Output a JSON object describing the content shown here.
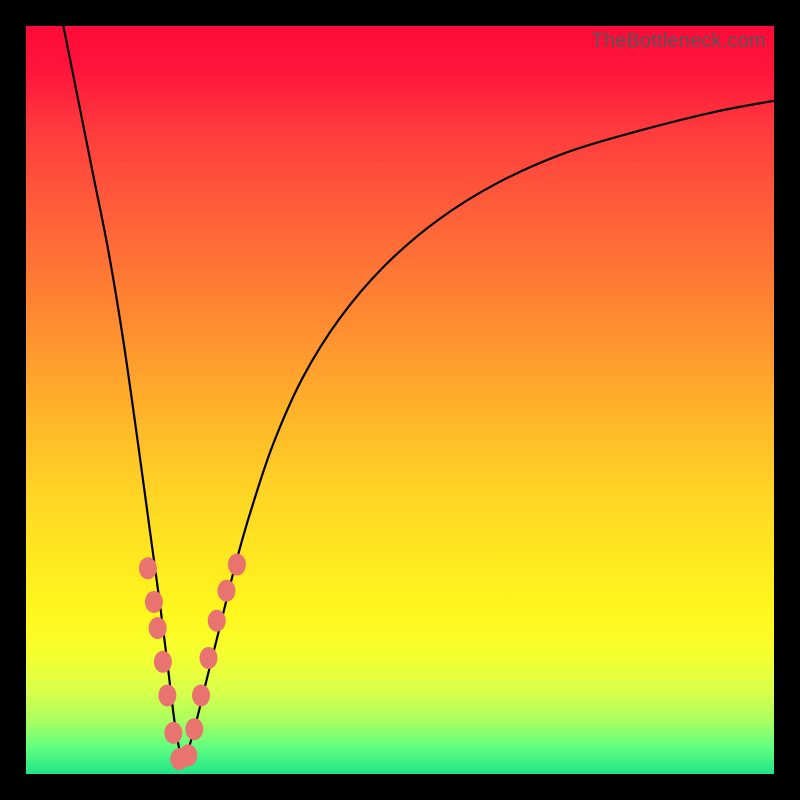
{
  "watermark": "TheBottleneck.com",
  "colors": {
    "background": "#000000",
    "gradient_top": "#ff0a3a",
    "gradient_mid": "#ffd624",
    "gradient_bottom": "#20e588",
    "curve": "#000000",
    "bead": "#e8736f"
  },
  "chart_data": {
    "type": "line",
    "title": "",
    "xlabel": "",
    "ylabel": "",
    "xlim": [
      0,
      1
    ],
    "ylim": [
      0,
      1
    ],
    "description": "V-shaped bottleneck curve with a single sharp minimum near the left side, rising toward both edges; plotted on a red-to-green vertical gradient background with salmon beads clustered near the trough.",
    "minimum_x": 0.21,
    "series": [
      {
        "name": "left-branch",
        "x": [
          0.05,
          0.07,
          0.09,
          0.11,
          0.13,
          0.15,
          0.165,
          0.18,
          0.19,
          0.2,
          0.21
        ],
        "values": [
          1.0,
          0.9,
          0.8,
          0.7,
          0.58,
          0.44,
          0.33,
          0.22,
          0.14,
          0.06,
          0.01
        ]
      },
      {
        "name": "right-branch",
        "x": [
          0.21,
          0.225,
          0.24,
          0.26,
          0.28,
          0.3,
          0.33,
          0.37,
          0.42,
          0.48,
          0.55,
          0.63,
          0.72,
          0.82,
          0.92,
          1.0
        ],
        "values": [
          0.01,
          0.06,
          0.12,
          0.2,
          0.28,
          0.35,
          0.44,
          0.53,
          0.61,
          0.68,
          0.74,
          0.79,
          0.83,
          0.86,
          0.885,
          0.9
        ]
      },
      {
        "name": "beads-left",
        "x": [
          0.163,
          0.171,
          0.176,
          0.183,
          0.189,
          0.197,
          0.205
        ],
        "values": [
          0.275,
          0.23,
          0.195,
          0.15,
          0.105,
          0.055,
          0.02
        ]
      },
      {
        "name": "beads-right",
        "x": [
          0.217,
          0.225,
          0.234,
          0.244,
          0.255,
          0.268,
          0.282
        ],
        "values": [
          0.025,
          0.06,
          0.105,
          0.155,
          0.205,
          0.245,
          0.28
        ]
      }
    ]
  }
}
